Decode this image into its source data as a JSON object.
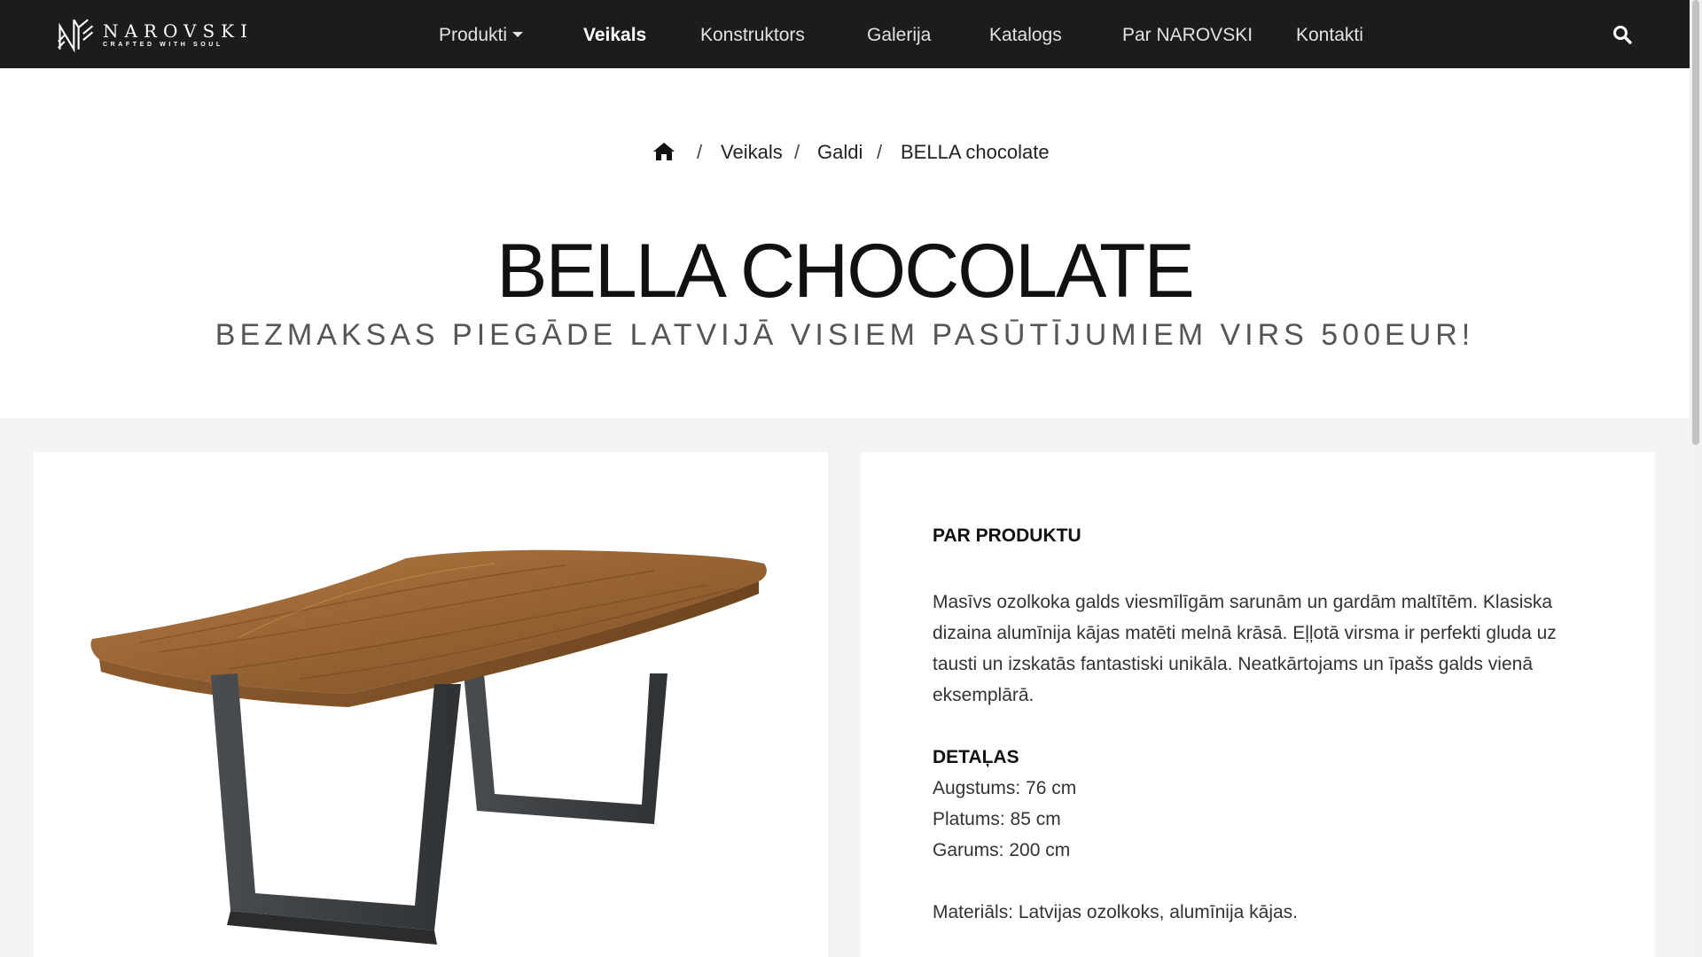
{
  "brand": {
    "name": "NAROVSKI",
    "tagline": "CRAFTED WITH SOUL"
  },
  "nav": {
    "items": [
      {
        "label": "Produkti",
        "dropdown": true
      },
      {
        "label": "Veikals",
        "active": true
      },
      {
        "label": "Konstruktors"
      },
      {
        "label": "Galerija"
      },
      {
        "label": "Katalogs"
      },
      {
        "label": "Par NAROVSKI"
      },
      {
        "label": "Kontakti"
      }
    ],
    "search_icon": "search-icon"
  },
  "breadcrumb": {
    "home_icon": "home-icon",
    "separator": "/",
    "items": [
      "Veikals",
      "Galdi",
      "BELLA chocolate"
    ]
  },
  "product": {
    "title": "BELLA CHOCOLATE",
    "subtitle": "BEZMAKSAS PIEGĀDE LATVIJĀ VISIEM PASŪTĪJUMIEM VIRS 500EUR!",
    "about_heading": "PAR PRODUKTU",
    "description": "Masīvs ozolkoka galds viesmīlīgām sarunām un gardām maltītēm. Klasiska dizaina alumīnija kājas matēti melnā krāsā. Eļļotā virsma ir perfekti gluda uz tausti un izskatās fantastiski unikāla. Neatkārtojams un īpašs galds vienā eksemplārā.",
    "details_heading": "DETAĻAS",
    "details": [
      "Augstums: 76 cm",
      "Platums: 85 cm",
      "Garums: 200 cm"
    ],
    "material": "Materiāls: Latvijas ozolkoks, alumīnija kājas."
  },
  "colors": {
    "navbar": "#1c1c1c",
    "content_bg": "#f3f3f3",
    "wood": "#9a6533",
    "legs": "#3d4043"
  }
}
